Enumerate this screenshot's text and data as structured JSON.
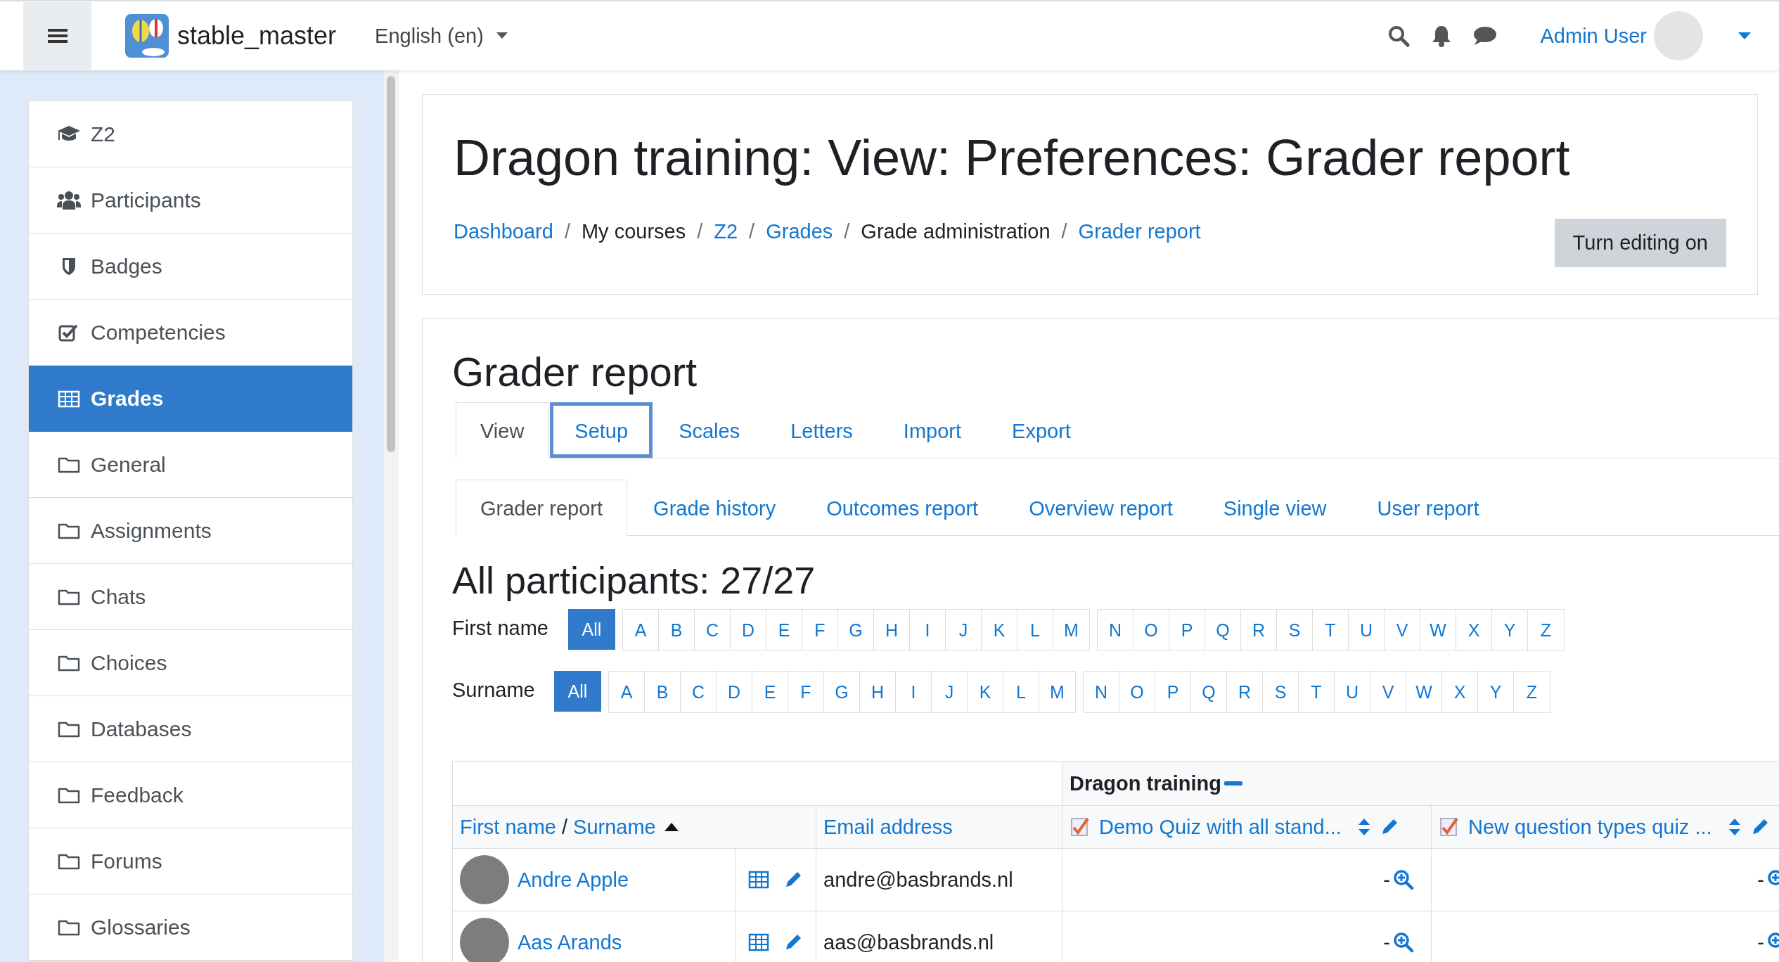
{
  "navbar": {
    "site_name": "stable_master",
    "language": "English (en)",
    "user_name": "Admin User"
  },
  "sidebar": {
    "items": [
      {
        "label": "Z2",
        "kind": "course",
        "selected": false
      },
      {
        "label": "Participants",
        "kind": "users",
        "selected": false
      },
      {
        "label": "Badges",
        "kind": "badge",
        "selected": false
      },
      {
        "label": "Competencies",
        "kind": "check",
        "selected": false
      },
      {
        "label": "Grades",
        "kind": "table",
        "selected": true
      },
      {
        "label": "General",
        "kind": "folder",
        "selected": false
      },
      {
        "label": "Assignments",
        "kind": "folder",
        "selected": false
      },
      {
        "label": "Chats",
        "kind": "folder",
        "selected": false
      },
      {
        "label": "Choices",
        "kind": "folder",
        "selected": false
      },
      {
        "label": "Databases",
        "kind": "folder",
        "selected": false
      },
      {
        "label": "Feedback",
        "kind": "folder",
        "selected": false
      },
      {
        "label": "Forums",
        "kind": "folder",
        "selected": false
      },
      {
        "label": "Glossaries",
        "kind": "folder",
        "selected": false
      }
    ]
  },
  "header": {
    "title": "Dragon training: View: Preferences: Grader report",
    "breadcrumb_separator": "/",
    "breadcrumb": [
      {
        "label": "Dashboard",
        "link": true
      },
      {
        "label": "My courses",
        "link": false
      },
      {
        "label": "Z2",
        "link": true
      },
      {
        "label": "Grades",
        "link": true
      },
      {
        "label": "Grade administration",
        "link": false
      },
      {
        "label": "Grader report",
        "link": true
      }
    ],
    "edit_button": "Turn editing on"
  },
  "report": {
    "heading": "Grader report",
    "tabs": [
      {
        "label": "View",
        "selected": true,
        "focused": false
      },
      {
        "label": "Setup",
        "selected": false,
        "focused": true
      },
      {
        "label": "Scales",
        "selected": false,
        "focused": false
      },
      {
        "label": "Letters",
        "selected": false,
        "focused": false
      },
      {
        "label": "Import",
        "selected": false,
        "focused": false
      },
      {
        "label": "Export",
        "selected": false,
        "focused": false
      }
    ],
    "subtabs": [
      {
        "label": "Grader report",
        "selected": true
      },
      {
        "label": "Grade history",
        "selected": false
      },
      {
        "label": "Outcomes report",
        "selected": false
      },
      {
        "label": "Overview report",
        "selected": false
      },
      {
        "label": "Single view",
        "selected": false
      },
      {
        "label": "User report",
        "selected": false
      }
    ],
    "participants_heading": "All participants: 27/27",
    "initials_filters": [
      {
        "label": "First name",
        "groups": [
          [
            {
              "label": "All",
              "selected": true
            }
          ],
          [
            {
              "label": "A",
              "selected": false
            },
            {
              "label": "B",
              "selected": false
            },
            {
              "label": "C",
              "selected": false
            },
            {
              "label": "D",
              "selected": false
            },
            {
              "label": "E",
              "selected": false
            },
            {
              "label": "F",
              "selected": false
            },
            {
              "label": "G",
              "selected": false
            },
            {
              "label": "H",
              "selected": false
            },
            {
              "label": "I",
              "selected": false
            },
            {
              "label": "J",
              "selected": false
            },
            {
              "label": "K",
              "selected": false
            },
            {
              "label": "L",
              "selected": false
            },
            {
              "label": "M",
              "selected": false
            }
          ],
          [
            {
              "label": "N",
              "selected": false
            },
            {
              "label": "O",
              "selected": false
            },
            {
              "label": "P",
              "selected": false
            },
            {
              "label": "Q",
              "selected": false
            },
            {
              "label": "R",
              "selected": false
            },
            {
              "label": "S",
              "selected": false
            },
            {
              "label": "T",
              "selected": false
            },
            {
              "label": "U",
              "selected": false
            },
            {
              "label": "V",
              "selected": false
            },
            {
              "label": "W",
              "selected": false
            },
            {
              "label": "X",
              "selected": false
            },
            {
              "label": "Y",
              "selected": false
            },
            {
              "label": "Z",
              "selected": false
            }
          ]
        ]
      },
      {
        "label": "Surname",
        "groups": [
          [
            {
              "label": "All",
              "selected": true
            }
          ],
          [
            {
              "label": "A",
              "selected": false
            },
            {
              "label": "B",
              "selected": false
            },
            {
              "label": "C",
              "selected": false
            },
            {
              "label": "D",
              "selected": false
            },
            {
              "label": "E",
              "selected": false
            },
            {
              "label": "F",
              "selected": false
            },
            {
              "label": "G",
              "selected": false
            },
            {
              "label": "H",
              "selected": false
            },
            {
              "label": "I",
              "selected": false
            },
            {
              "label": "J",
              "selected": false
            },
            {
              "label": "K",
              "selected": false
            },
            {
              "label": "L",
              "selected": false
            },
            {
              "label": "M",
              "selected": false
            }
          ],
          [
            {
              "label": "N",
              "selected": false
            },
            {
              "label": "O",
              "selected": false
            },
            {
              "label": "P",
              "selected": false
            },
            {
              "label": "Q",
              "selected": false
            },
            {
              "label": "R",
              "selected": false
            },
            {
              "label": "S",
              "selected": false
            },
            {
              "label": "T",
              "selected": false
            },
            {
              "label": "U",
              "selected": false
            },
            {
              "label": "V",
              "selected": false
            },
            {
              "label": "W",
              "selected": false
            },
            {
              "label": "X",
              "selected": false
            },
            {
              "label": "Y",
              "selected": false
            },
            {
              "label": "Z",
              "selected": false
            }
          ]
        ]
      }
    ],
    "table": {
      "category": "Dragon training",
      "name_header": {
        "first": "First name",
        "separator": "/",
        "last": "Surname"
      },
      "email_header": "Email address",
      "grade_items": [
        "Demo Quiz with all stand...",
        "New question types quiz ..."
      ],
      "rows": [
        {
          "name": "Andre Apple",
          "email": "andre@basbrands.nl",
          "grades": [
            "-",
            "-"
          ]
        },
        {
          "name": "Aas Arands",
          "email": "aas@basbrands.nl",
          "grades": [
            "-",
            "-"
          ]
        }
      ]
    }
  }
}
